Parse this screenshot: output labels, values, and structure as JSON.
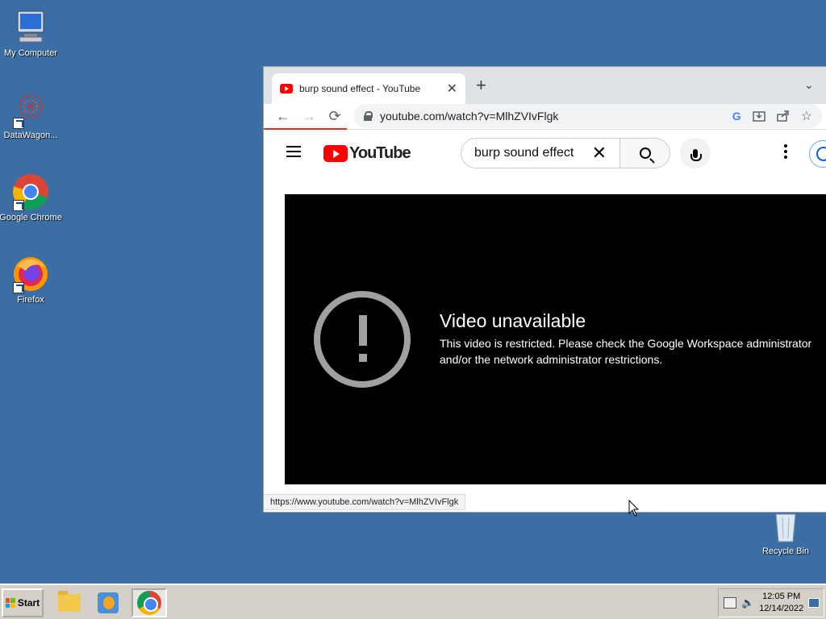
{
  "desktop": {
    "icons": [
      {
        "label": "My Computer",
        "icon": "my-computer-icon"
      },
      {
        "label": "DataWagon...",
        "icon": "datawagon-icon"
      },
      {
        "label": "Google Chrome",
        "icon": "chrome-icon"
      },
      {
        "label": "Firefox",
        "icon": "firefox-icon"
      },
      {
        "label": "Recycle Bin",
        "icon": "recycle-bin-icon"
      }
    ]
  },
  "browser": {
    "tab_title": "burp sound effect - YouTube",
    "tab_close": "✕",
    "new_tab": "+",
    "tab_dropdown": "⌄",
    "back": "←",
    "forward": "→",
    "reload": "⟳",
    "url": "youtube.com/watch?v=MlhZVIvFlgk",
    "status_url": "https://www.youtube.com/watch?v=MlhZVIvFlgk"
  },
  "youtube": {
    "logo_text": "YouTube",
    "search_query": "burp sound effect",
    "clear": "✕",
    "error_title": "Video unavailable",
    "error_message": "This video is restricted. Please check the Google Workspace administrator and/or the network administrator restrictions."
  },
  "taskbar": {
    "start_label": "Start",
    "time": "12:05 PM",
    "date": "12/14/2022"
  },
  "colors": {
    "desktop": "#3a6ea5",
    "youtube_red": "#ff0000"
  }
}
